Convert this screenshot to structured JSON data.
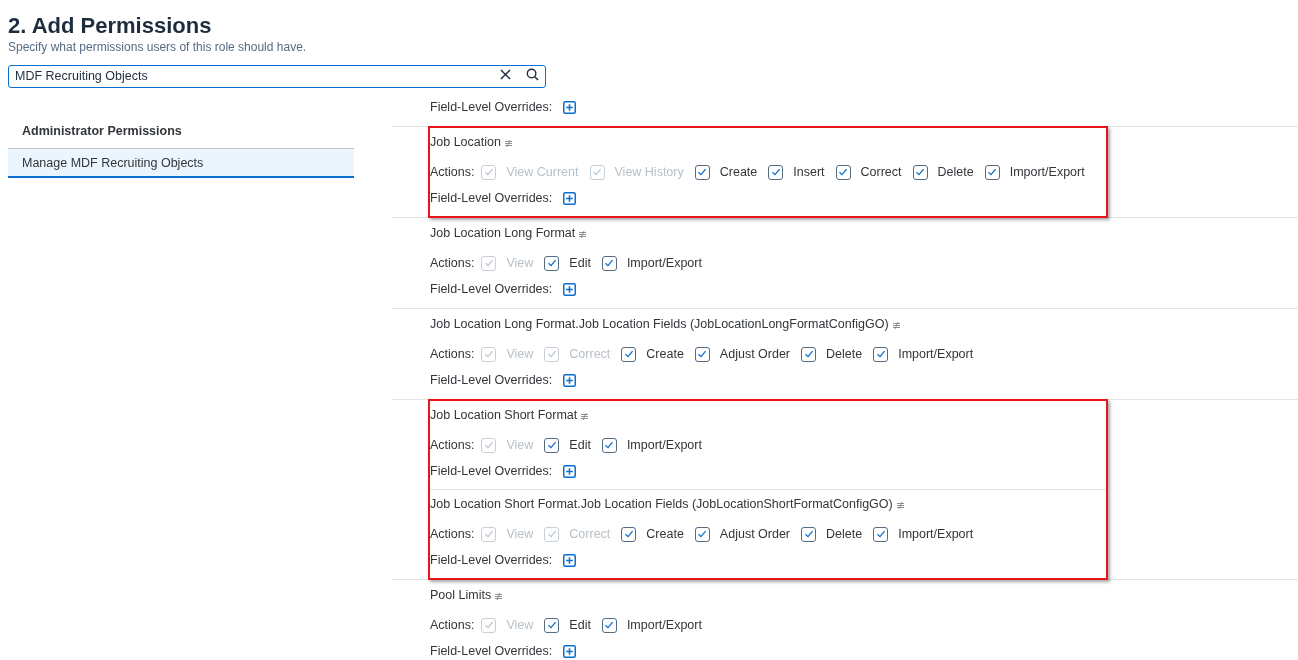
{
  "header": {
    "title": "2. Add Permissions",
    "subtitle": "Specify what permissions users of this role should have."
  },
  "search": {
    "value": "MDF Recruiting Objects"
  },
  "sidebar": {
    "heading": "Administrator Permissions",
    "items": [
      {
        "label": "Manage MDF Recruiting Objects",
        "selected": true
      }
    ]
  },
  "groups": [
    {
      "highlighted": false,
      "sections": [
        {
          "overrides_label": "Field-Level Overrides:"
        }
      ]
    },
    {
      "highlighted": true,
      "sections": [
        {
          "title": "Job Location",
          "actions_label": "Actions:",
          "actions": [
            {
              "label": "View Current",
              "checked": true,
              "disabled": true
            },
            {
              "label": "View History",
              "checked": true,
              "disabled": true
            },
            {
              "label": "Create",
              "checked": true,
              "disabled": false
            },
            {
              "label": "Insert",
              "checked": true,
              "disabled": false
            },
            {
              "label": "Correct",
              "checked": true,
              "disabled": false
            },
            {
              "label": "Delete",
              "checked": true,
              "disabled": false
            },
            {
              "label": "Import/Export",
              "checked": true,
              "disabled": false
            }
          ],
          "overrides_label": "Field-Level Overrides:"
        }
      ]
    },
    {
      "highlighted": false,
      "sections": [
        {
          "title": "Job Location Long Format",
          "actions_label": "Actions:",
          "actions": [
            {
              "label": "View",
              "checked": true,
              "disabled": true
            },
            {
              "label": "Edit",
              "checked": true,
              "disabled": false
            },
            {
              "label": "Import/Export",
              "checked": true,
              "disabled": false
            }
          ],
          "overrides_label": "Field-Level Overrides:"
        }
      ]
    },
    {
      "highlighted": false,
      "sections": [
        {
          "title": "Job Location Long Format.Job Location Fields (JobLocationLongFormatConfigGO)",
          "actions_label": "Actions:",
          "actions": [
            {
              "label": "View",
              "checked": true,
              "disabled": true
            },
            {
              "label": "Correct",
              "checked": true,
              "disabled": true
            },
            {
              "label": "Create",
              "checked": true,
              "disabled": false
            },
            {
              "label": "Adjust Order",
              "checked": true,
              "disabled": false
            },
            {
              "label": "Delete",
              "checked": true,
              "disabled": false
            },
            {
              "label": "Import/Export",
              "checked": true,
              "disabled": false
            }
          ],
          "overrides_label": "Field-Level Overrides:"
        }
      ]
    },
    {
      "highlighted": true,
      "sections": [
        {
          "title": "Job Location Short Format",
          "actions_label": "Actions:",
          "actions": [
            {
              "label": "View",
              "checked": true,
              "disabled": true
            },
            {
              "label": "Edit",
              "checked": true,
              "disabled": false
            },
            {
              "label": "Import/Export",
              "checked": true,
              "disabled": false
            }
          ],
          "overrides_label": "Field-Level Overrides:"
        },
        {
          "title": "Job Location Short Format.Job Location Fields (JobLocationShortFormatConfigGO)",
          "actions_label": "Actions:",
          "actions": [
            {
              "label": "View",
              "checked": true,
              "disabled": true
            },
            {
              "label": "Correct",
              "checked": true,
              "disabled": true
            },
            {
              "label": "Create",
              "checked": true,
              "disabled": false
            },
            {
              "label": "Adjust Order",
              "checked": true,
              "disabled": false
            },
            {
              "label": "Delete",
              "checked": true,
              "disabled": false
            },
            {
              "label": "Import/Export",
              "checked": true,
              "disabled": false
            }
          ],
          "overrides_label": "Field-Level Overrides:"
        }
      ]
    },
    {
      "highlighted": false,
      "sections": [
        {
          "title": "Pool Limits",
          "actions_label": "Actions:",
          "actions": [
            {
              "label": "View",
              "checked": true,
              "disabled": true
            },
            {
              "label": "Edit",
              "checked": true,
              "disabled": false
            },
            {
              "label": "Import/Export",
              "checked": true,
              "disabled": false
            }
          ],
          "overrides_label": "Field-Level Overrides:"
        }
      ]
    }
  ]
}
